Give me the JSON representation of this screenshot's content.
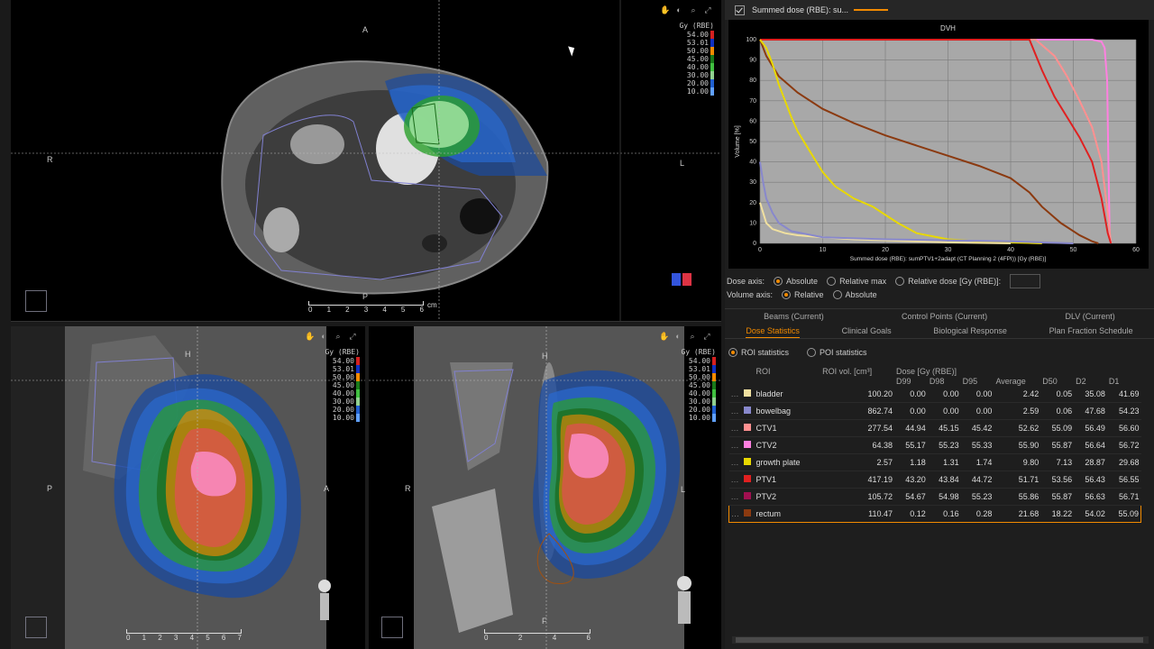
{
  "viewports": {
    "axial": {
      "legend_unit": "Gy (RBE)",
      "legend_levels": [
        {
          "value": "54.00",
          "color": "#d42020"
        },
        {
          "value": "53.01",
          "color": "#1030c0"
        },
        {
          "value": "50.00",
          "color": "#f28a00"
        },
        {
          "value": "45.00",
          "color": "#1a7a1a"
        },
        {
          "value": "40.00",
          "color": "#40c040"
        },
        {
          "value": "30.00",
          "color": "#90d090"
        },
        {
          "value": "20.00",
          "color": "#2060d0"
        },
        {
          "value": "10.00",
          "color": "#60a0ff"
        }
      ],
      "orient_top": "A",
      "orient_bottom": "P",
      "orient_left": "R",
      "orient_right": "L",
      "scale_nums": [
        "0",
        "1",
        "2",
        "3",
        "4",
        "5",
        "6"
      ],
      "scale_unit": "cm"
    },
    "sagittal": {
      "legend_unit": "Gy (RBE)",
      "legend_levels": [
        {
          "value": "54.00",
          "color": "#d42020"
        },
        {
          "value": "53.01",
          "color": "#1030c0"
        },
        {
          "value": "50.00",
          "color": "#f28a00"
        },
        {
          "value": "45.00",
          "color": "#1a7a1a"
        },
        {
          "value": "40.00",
          "color": "#40c040"
        },
        {
          "value": "30.00",
          "color": "#90d090"
        },
        {
          "value": "20.00",
          "color": "#2060d0"
        },
        {
          "value": "10.00",
          "color": "#60a0ff"
        }
      ],
      "orient_top": "H",
      "orient_left": "P",
      "orient_right": "A",
      "scale_nums": [
        "0",
        "1",
        "2",
        "3",
        "4",
        "5",
        "6",
        "7"
      ]
    },
    "coronal": {
      "legend_unit": "Gy (RBE)",
      "legend_levels": [
        {
          "value": "54.00",
          "color": "#d42020"
        },
        {
          "value": "53.01",
          "color": "#1030c0"
        },
        {
          "value": "50.00",
          "color": "#f28a00"
        },
        {
          "value": "45.00",
          "color": "#1a7a1a"
        },
        {
          "value": "40.00",
          "color": "#40c040"
        },
        {
          "value": "30.00",
          "color": "#90d090"
        },
        {
          "value": "20.00",
          "color": "#2060d0"
        },
        {
          "value": "10.00",
          "color": "#60a0ff"
        }
      ],
      "orient_top": "H",
      "orient_bottom": "F",
      "orient_left": "R",
      "orient_right": "L",
      "scale_nums": [
        "0",
        "2",
        "4",
        "6"
      ]
    }
  },
  "dvh": {
    "header_title": "Summed dose (RBE): su...",
    "header_line_color": "#f28a00",
    "chart_data": {
      "type": "line",
      "title": "DVH",
      "xlabel": "Summed dose (RBE): sumPTV1+2adapt (CT Planning 2 (4FPI)) [Gy (RBE)]",
      "ylabel": "Volume [%]",
      "xlim": [
        0,
        60
      ],
      "ylim": [
        0,
        100
      ],
      "xticks": [
        0,
        10,
        20,
        30,
        40,
        50,
        60
      ],
      "yticks": [
        0,
        10,
        20,
        30,
        40,
        50,
        60,
        70,
        80,
        90,
        100
      ],
      "grid": true,
      "series": [
        {
          "color": "#ff80e0",
          "x": [
            0,
            53,
            54.5,
            55,
            55.4,
            55.6,
            55.8,
            56
          ],
          "y": [
            100,
            100,
            99,
            96,
            80,
            40,
            5,
            0
          ]
        },
        {
          "color": "#ff9090",
          "x": [
            0,
            44,
            47,
            49,
            51,
            53,
            54.5,
            55.5,
            56
          ],
          "y": [
            100,
            100,
            92,
            82,
            70,
            57,
            40,
            15,
            0
          ]
        },
        {
          "color": "#e02020",
          "x": [
            0,
            43,
            45,
            47,
            49,
            51,
            53,
            54.5,
            55.5,
            56
          ],
          "y": [
            100,
            100,
            85,
            72,
            62,
            52,
            40,
            22,
            5,
            0
          ]
        },
        {
          "color": "#8b3a10",
          "x": [
            0,
            1,
            3,
            6,
            10,
            15,
            20,
            25,
            30,
            35,
            40,
            43,
            45,
            48,
            51,
            53,
            54
          ],
          "y": [
            100,
            92,
            82,
            74,
            66,
            59,
            53,
            48,
            43,
            38,
            32,
            25,
            18,
            10,
            4,
            1,
            0
          ]
        },
        {
          "color": "#e8d800",
          "x": [
            0,
            1,
            2,
            3,
            4,
            5,
            6,
            8,
            10,
            12,
            15,
            18,
            20,
            22,
            25,
            30,
            35,
            40,
            45
          ],
          "y": [
            100,
            96,
            88,
            78,
            70,
            62,
            55,
            45,
            35,
            28,
            22,
            18,
            14,
            10,
            5,
            2,
            1,
            0.5,
            0
          ]
        },
        {
          "color": "#f0e0a0",
          "x": [
            0,
            0.5,
            1,
            2,
            4,
            6,
            10,
            15,
            20,
            25,
            30,
            35,
            40
          ],
          "y": [
            20,
            15,
            10,
            7,
            5,
            4,
            3,
            2,
            1.5,
            1,
            0.5,
            0.2,
            0
          ]
        },
        {
          "color": "#8888cc",
          "x": [
            0,
            0.5,
            1,
            2,
            3,
            5,
            10,
            20,
            30,
            40,
            50
          ],
          "y": [
            40,
            30,
            22,
            15,
            10,
            6,
            3,
            2,
            1.5,
            1,
            0
          ]
        }
      ]
    },
    "dose_axis_label": "Dose axis:",
    "dose_axis_options": [
      "Absolute",
      "Relative max",
      "Relative dose [Gy (RBE)]:"
    ],
    "volume_axis_label": "Volume axis:",
    "volume_axis_options": [
      "Relative",
      "Absolute"
    ]
  },
  "tabs_row1": [
    "Beams (Current)",
    "Control Points (Current)",
    "DLV (Current)"
  ],
  "tabs_row2": [
    "Dose Statistics",
    "Clinical Goals",
    "Biological Response",
    "Plan Fraction Schedule"
  ],
  "stat_options": [
    "ROI statistics",
    "POI statistics"
  ],
  "table": {
    "headers": {
      "roi": "ROI",
      "vol": "ROI vol. [cm³]",
      "dose_group": "Dose [Gy (RBE)]",
      "d99": "D99",
      "d98": "D98",
      "d95": "D95",
      "avg": "Average",
      "d50": "D50",
      "d2": "D2",
      "d1": "D1"
    },
    "rows": [
      {
        "name": "bladder",
        "color": "#f0e0a0",
        "vol": "100.20",
        "d99": "0.00",
        "d98": "0.00",
        "d95": "0.00",
        "avg": "2.42",
        "d50": "0.05",
        "d2": "35.08",
        "d1": "41.69"
      },
      {
        "name": "bowelbag",
        "color": "#8888cc",
        "vol": "862.74",
        "d99": "0.00",
        "d98": "0.00",
        "d95": "0.00",
        "avg": "2.59",
        "d50": "0.06",
        "d2": "47.68",
        "d1": "54.23"
      },
      {
        "name": "CTV1",
        "color": "#ff9090",
        "vol": "277.54",
        "d99": "44.94",
        "d98": "45.15",
        "d95": "45.42",
        "avg": "52.62",
        "d50": "55.09",
        "d2": "56.49",
        "d1": "56.60"
      },
      {
        "name": "CTV2",
        "color": "#ff80e0",
        "vol": "64.38",
        "d99": "55.17",
        "d98": "55.23",
        "d95": "55.33",
        "avg": "55.90",
        "d50": "55.87",
        "d2": "56.64",
        "d1": "56.72"
      },
      {
        "name": "growth plate",
        "color": "#e8d800",
        "vol": "2.57",
        "d99": "1.18",
        "d98": "1.31",
        "d95": "1.74",
        "avg": "9.80",
        "d50": "7.13",
        "d2": "28.87",
        "d1": "29.68"
      },
      {
        "name": "PTV1",
        "color": "#e02020",
        "vol": "417.19",
        "d99": "43.20",
        "d98": "43.84",
        "d95": "44.72",
        "avg": "51.71",
        "d50": "53.56",
        "d2": "56.43",
        "d1": "56.55"
      },
      {
        "name": "PTV2",
        "color": "#a01050",
        "vol": "105.72",
        "d99": "54.67",
        "d98": "54.98",
        "d95": "55.23",
        "avg": "55.86",
        "d50": "55.87",
        "d2": "56.63",
        "d1": "56.71"
      },
      {
        "name": "rectum",
        "color": "#8b3a10",
        "vol": "110.47",
        "d99": "0.12",
        "d98": "0.16",
        "d95": "0.28",
        "avg": "21.68",
        "d50": "18.22",
        "d2": "54.02",
        "d1": "55.09"
      }
    ]
  }
}
